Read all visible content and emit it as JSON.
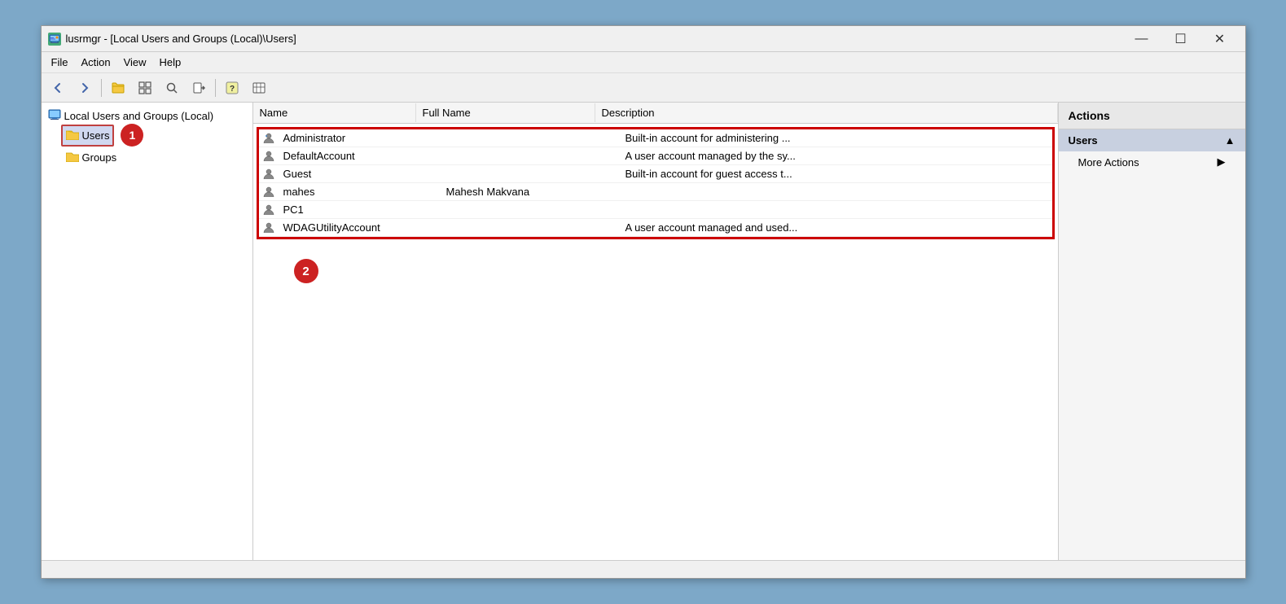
{
  "window": {
    "title": "lusrmgr - [Local Users and Groups (Local)\\Users]",
    "icon": "🖥"
  },
  "titlebar": {
    "minimize": "—",
    "maximize": "☐",
    "close": "✕"
  },
  "menu": {
    "items": [
      "File",
      "Action",
      "View",
      "Help"
    ]
  },
  "toolbar": {
    "buttons": [
      "←",
      "→",
      "📁",
      "📋",
      "🔍",
      "📤",
      "❓",
      "📊"
    ]
  },
  "sidebar": {
    "root_label": "Local Users and Groups (Local)",
    "children": [
      {
        "id": "users",
        "label": "Users",
        "selected": true
      },
      {
        "id": "groups",
        "label": "Groups",
        "selected": false
      }
    ]
  },
  "table": {
    "columns": [
      "Name",
      "Full Name",
      "Description"
    ],
    "rows": [
      {
        "name": "Administrator",
        "fullname": "",
        "description": "Built-in account for administering ..."
      },
      {
        "name": "DefaultAccount",
        "fullname": "",
        "description": "A user account managed by the sy..."
      },
      {
        "name": "Guest",
        "fullname": "",
        "description": "Built-in account for guest access t..."
      },
      {
        "name": "mahes",
        "fullname": "Mahesh Makvana",
        "description": ""
      },
      {
        "name": "PC1",
        "fullname": "",
        "description": ""
      },
      {
        "name": "WDAGUtilityAccount",
        "fullname": "",
        "description": "A user account managed and used..."
      }
    ]
  },
  "annotations": {
    "circle1": "1",
    "circle2": "2"
  },
  "actions_panel": {
    "title": "Actions",
    "sections": [
      {
        "label": "Users",
        "items": [
          {
            "label": "More Actions",
            "has_arrow": true
          }
        ]
      }
    ]
  },
  "status_bar": {
    "text": ""
  },
  "colors": {
    "red_border": "#cc0000",
    "annotation_circle": "#cc2222",
    "selected_bg": "#c8d0e0",
    "actions_section_bg": "#c8d0e0"
  }
}
